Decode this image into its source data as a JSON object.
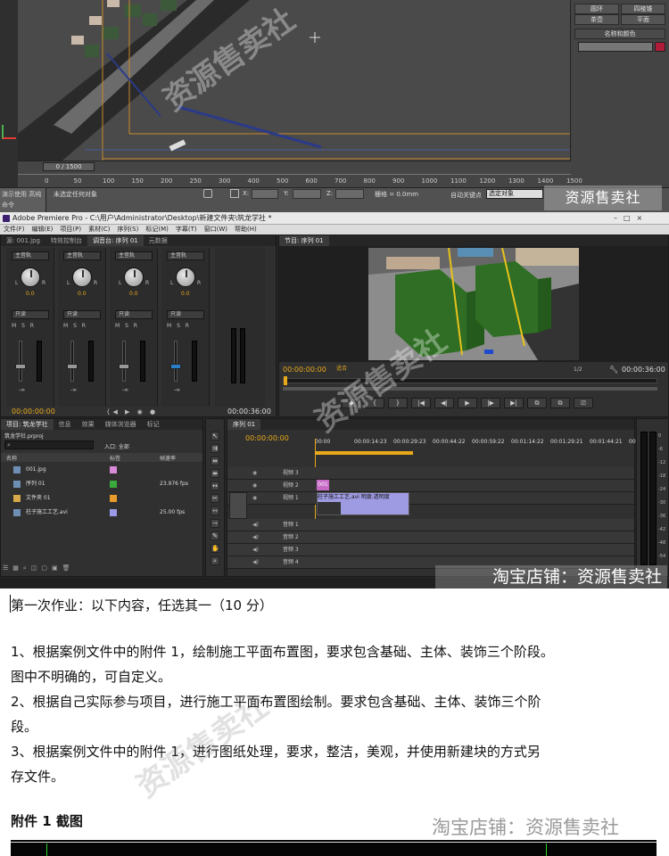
{
  "max": {
    "right_panel": {
      "buttons": [
        "圆环",
        "四棱锥",
        "茶壶",
        "平面"
      ],
      "name_color_label": "名称和颜色",
      "name_value": ""
    },
    "timeline": {
      "counter": "0 / 1500",
      "ticks": [
        "0",
        "50",
        "100",
        "150",
        "200",
        "250",
        "300",
        "400",
        "500",
        "600",
        "700",
        "800",
        "900",
        "1000",
        "1100",
        "1200",
        "1300",
        "1400",
        "1500"
      ]
    },
    "status": {
      "selection": "未选定任何对象",
      "x_label": "X:",
      "y_label": "Y:",
      "z_label": "Z:",
      "grid_label": "栅格 = 0.0mm",
      "autokey_label": "自动关键点",
      "selected_label": "选定对象",
      "left_text": "演示使用 高纯",
      "left_sub": "命令"
    }
  },
  "premiere": {
    "window_title": "Adobe Premiere Pro - C:\\用户\\Administrator\\Desktop\\新建文件夹\\筑龙学社 *",
    "menu": [
      "文件(F)",
      "编辑(E)",
      "项目(P)",
      "素材(C)",
      "序列(S)",
      "标记(M)",
      "字幕(T)",
      "窗口(W)",
      "帮助(H)"
    ],
    "mixer": {
      "tabs": [
        "源: 001.jpg",
        "特效控制台",
        "调音台: 序列 01",
        "元数据"
      ],
      "channels": [
        {
          "track": "主音轨",
          "value": "0.0",
          "mode": "只读"
        },
        {
          "track": "主音轨",
          "value": "0.0",
          "mode": "只读"
        },
        {
          "track": "主音轨",
          "value": "0.0",
          "mode": "只读"
        },
        {
          "track": "主音轨",
          "value": "0.0",
          "mode": "只读"
        }
      ],
      "lr": [
        "L",
        "R"
      ],
      "db": [
        "-∞",
        "-∞",
        "-∞",
        "-∞"
      ],
      "time_left": "00:00:00:00",
      "time_right": "00:00:36:00"
    },
    "program": {
      "tab": "节目: 序列 01",
      "time_current": "00:00:00:00",
      "fit": "适合",
      "page": "1/2",
      "time_total": "00:00:36:00"
    },
    "project": {
      "tabs": [
        "项目: 筑龙学社",
        "信息",
        "效果",
        "媒体浏览器",
        "标记"
      ],
      "file": "筑龙学社.prproj",
      "items_count": "5 项",
      "entry_label": "入口: 全部",
      "columns": [
        "名称",
        "标签",
        "帧速率"
      ],
      "rows": [
        {
          "name": "001.jpg",
          "rate": "",
          "color": "#d88ad8"
        },
        {
          "name": "序列 01",
          "rate": "23.976 fps",
          "color": "#3aaa3a"
        },
        {
          "name": "文件夹 01",
          "rate": "",
          "color": "#e89a2a"
        },
        {
          "name": "柱子施工工艺.avi",
          "rate": "25.00 fps",
          "color": "#9a9ae8"
        }
      ]
    },
    "timeline": {
      "tab": "序列 01",
      "time": "00:00:00:00",
      "ruler": [
        "00:00",
        "00:00:14:23",
        "00:00:29:23",
        "00:00:44:22",
        "00:00:59:22",
        "00:01:14:22",
        "00:01:29:21",
        "00:01:44:21",
        "00:01"
      ],
      "video_tracks": [
        "视频 3",
        "视频 2",
        "视频 1"
      ],
      "audio_tracks": [
        "音频 1",
        "音频 2",
        "音频 3",
        "音频 4"
      ],
      "clip_still": "001",
      "clip_video": "柱子施工工艺.avi 明度:透明度"
    }
  },
  "watermarks": {
    "shop_1": "资源售卖社",
    "shop_2": "淘宝店铺：资源售卖社",
    "diag": "资源售卖社"
  },
  "doc": {
    "title": "第一次作业：以下内容，任选其一（10 分）",
    "items": [
      "1、根据案例文件中的附件 1，绘制施工平面布置图，要求包含基础、主体、装饰三个阶段。",
      "图中不明确的，可自定义。",
      "2、根据自己实际参与项目，进行施工平面布置图绘制。要求包含基础、主体、装饰三个阶",
      "段。",
      "3、根据案例文件中的附件 1，进行图纸处理，要求，整洁，美观，并使用新建块的方式另",
      "存文件。"
    ],
    "attachment_heading": "附件 1 截图"
  }
}
